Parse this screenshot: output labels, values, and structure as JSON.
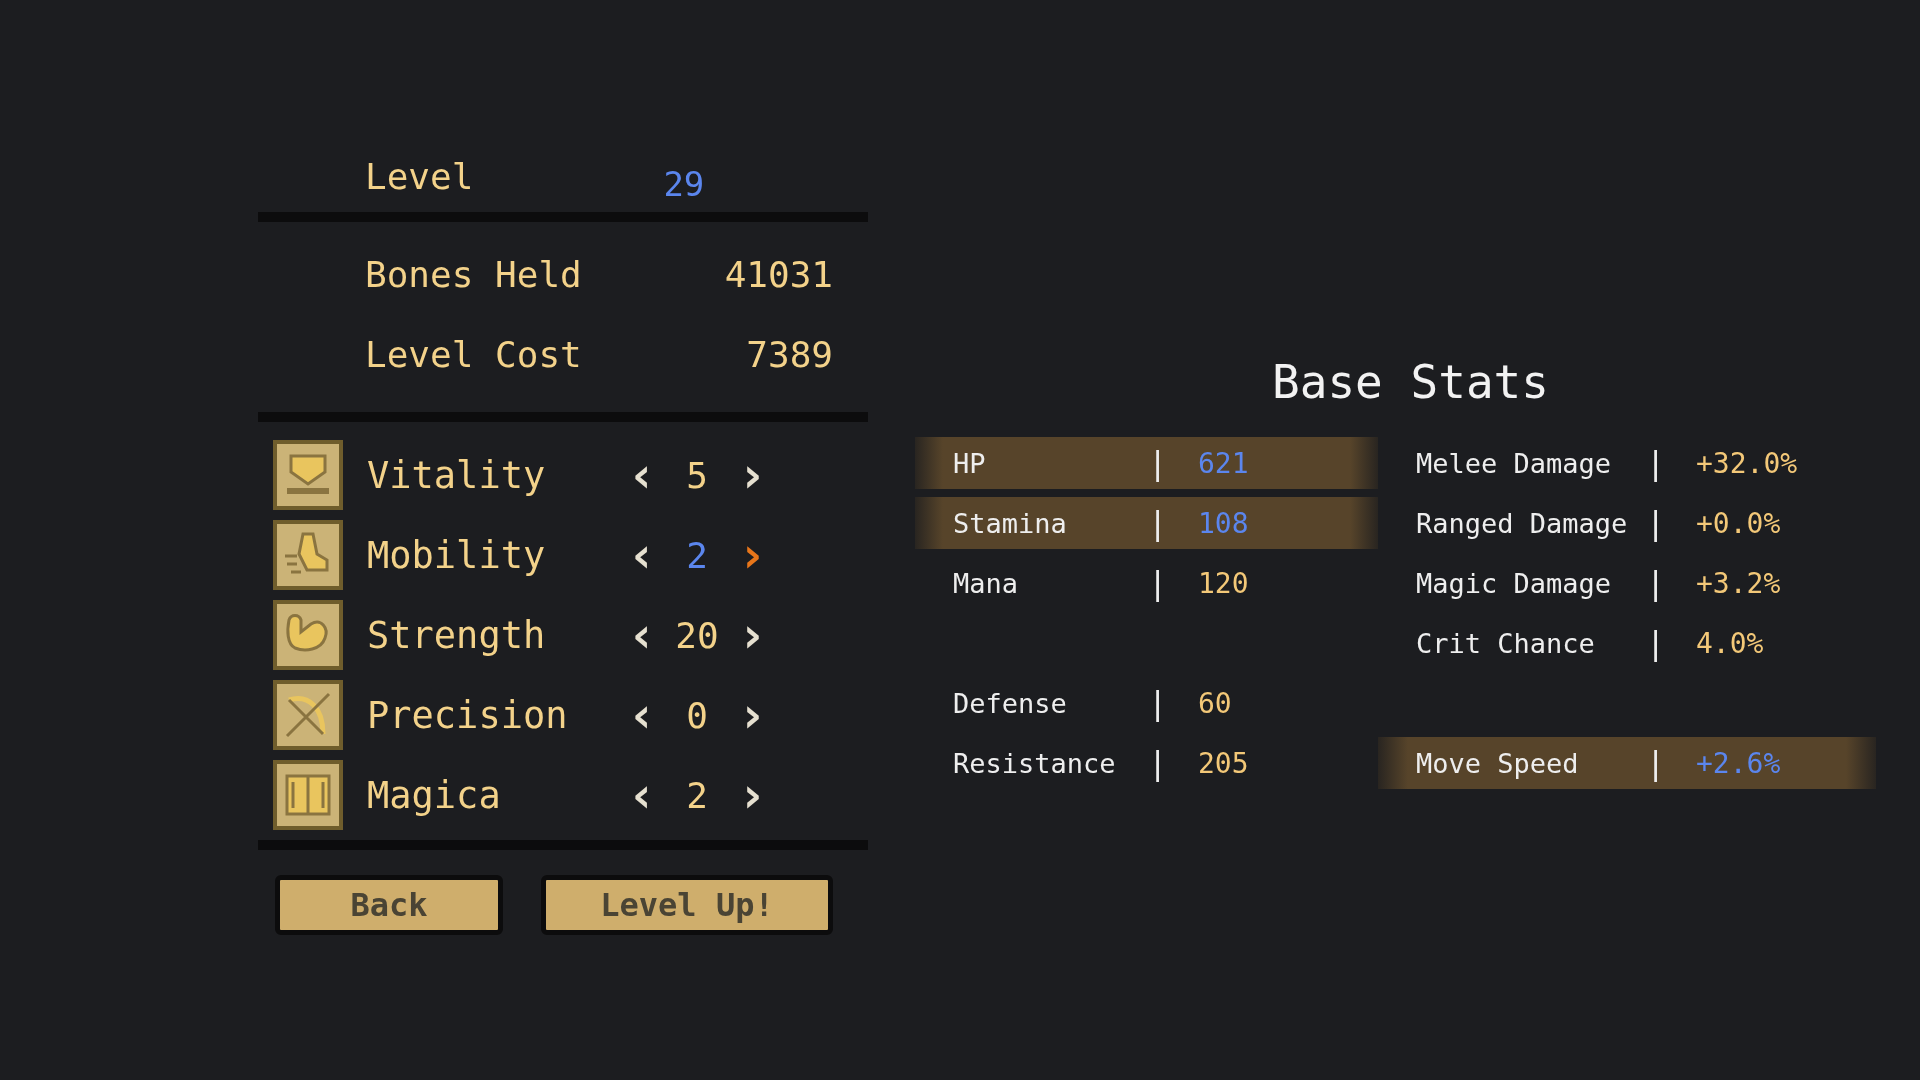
{
  "summary": {
    "level_label": "Level",
    "level_value": "29",
    "rows": [
      {
        "label": "Bones Held",
        "value": "41031"
      },
      {
        "label": "Level Cost",
        "value": "7389"
      }
    ]
  },
  "attributes": [
    {
      "name": "Vitality",
      "value": "5",
      "selected": false,
      "left": "‹",
      "right": "›"
    },
    {
      "name": "Mobility",
      "value": "2",
      "selected": true,
      "left": "‹",
      "right": "›"
    },
    {
      "name": "Strength",
      "value": "20",
      "selected": false,
      "left": "‹",
      "right": "›"
    },
    {
      "name": "Precision",
      "value": "0",
      "selected": false,
      "left": "‹",
      "right": "›"
    },
    {
      "name": "Magica",
      "value": "2",
      "selected": false,
      "left": "‹",
      "right": "›"
    }
  ],
  "buttons": [
    {
      "label": "Back"
    },
    {
      "label": "Level Up!"
    }
  ],
  "base_stats": {
    "title": "Base Stats",
    "columns": [
      [
        {
          "kind": "stat",
          "label": "HP",
          "sep": "|",
          "value": "621",
          "highlighted": true
        },
        {
          "kind": "stat",
          "label": "Stamina",
          "sep": "|",
          "value": "108",
          "highlighted": true
        },
        {
          "kind": "stat",
          "label": "Mana",
          "sep": "|",
          "value": "120",
          "highlighted": false
        },
        {
          "kind": "spacer"
        },
        {
          "kind": "stat",
          "label": "Defense",
          "sep": "|",
          "value": "60",
          "highlighted": false
        },
        {
          "kind": "stat",
          "label": "Resistance",
          "sep": "|",
          "value": "205",
          "highlighted": false
        }
      ],
      [
        {
          "kind": "stat",
          "label": "Melee Damage",
          "sep": "|",
          "value": "+32.0%",
          "highlighted": false
        },
        {
          "kind": "stat",
          "label": "Ranged Damage",
          "sep": "|",
          "value": "+0.0%",
          "highlighted": false
        },
        {
          "kind": "stat",
          "label": "Magic Damage",
          "sep": "|",
          "value": "+3.2%",
          "highlighted": false
        },
        {
          "kind": "stat",
          "label": "Crit Chance",
          "sep": "|",
          "value": "4.0%",
          "highlighted": false
        },
        {
          "kind": "spacer"
        },
        {
          "kind": "stat",
          "label": "Move Speed",
          "sep": "|",
          "value": "+2.6%",
          "highlighted": true
        }
      ]
    ]
  }
}
